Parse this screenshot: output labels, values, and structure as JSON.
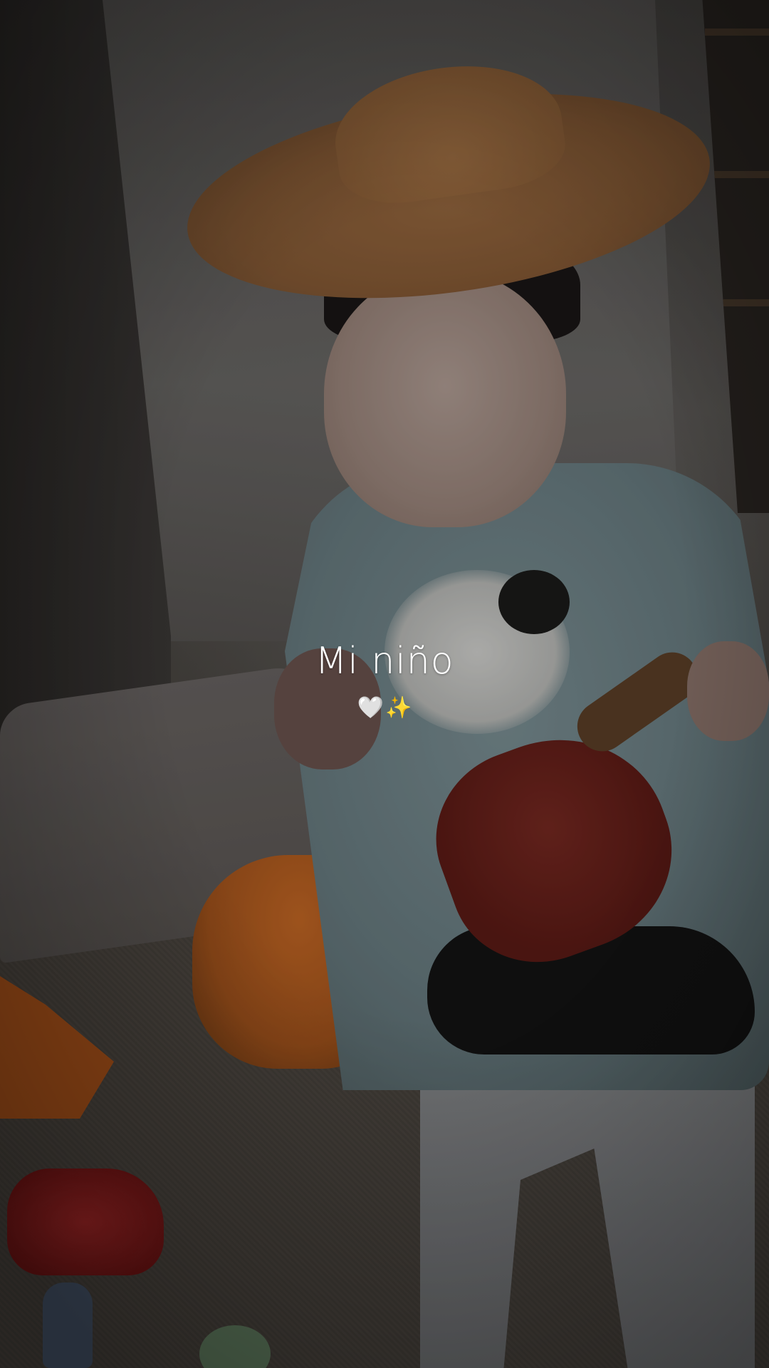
{
  "story": {
    "caption": "Mi niño",
    "emojis": {
      "heart": "🤍",
      "sparkles": "✨"
    }
  },
  "colors": {
    "caption_text": "#ffffff",
    "sparkles": "#f3c241"
  }
}
